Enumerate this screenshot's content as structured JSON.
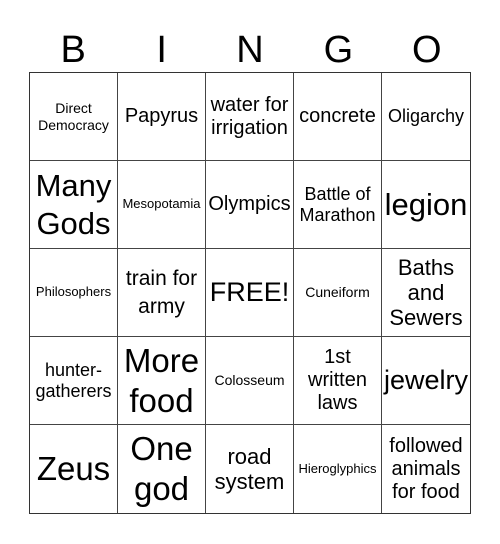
{
  "header": {
    "letters": [
      "B",
      "I",
      "N",
      "G",
      "O"
    ]
  },
  "cells": [
    "Direct Democracy",
    "Papyrus",
    "water for irrigation",
    "concrete",
    "Oligarchy",
    "Many Gods",
    "Mesopotamia",
    "Olympics",
    "Battle of Marathon",
    "legion",
    "Philosophers",
    "train for army",
    "FREE!",
    "Cuneiform",
    "Baths and Sewers",
    "hunter-gatherers",
    "More food",
    "Colosseum",
    "1st written laws",
    "jewelry",
    "Zeus",
    "One god",
    "road system",
    "Hieroglyphics",
    "followed animals for food"
  ]
}
